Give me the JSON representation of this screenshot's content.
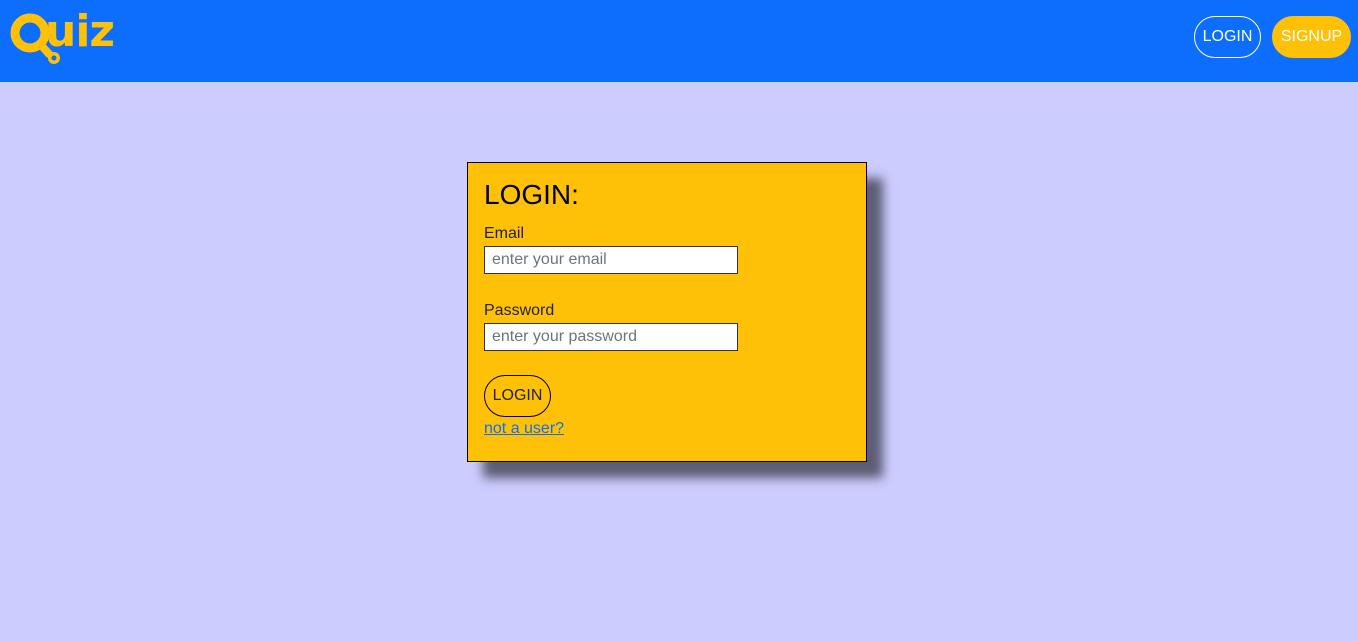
{
  "header": {
    "logo_text": "uiz",
    "login_label": "LOGIN",
    "signup_label": "SIGNUP"
  },
  "login_form": {
    "title": "LOGIN:",
    "email_label": "Email",
    "email_placeholder": "enter your email",
    "email_value": "",
    "password_label": "Password",
    "password_placeholder": "enter your password",
    "password_value": "",
    "submit_label": "LOGIN",
    "register_link": "not a user?"
  },
  "colors": {
    "navbar": "#0d6efd",
    "accent": "#ffc107",
    "background": "#ccccff",
    "link": "#0d6efd"
  },
  "icons": {
    "logo": "magnifier-q-icon"
  }
}
